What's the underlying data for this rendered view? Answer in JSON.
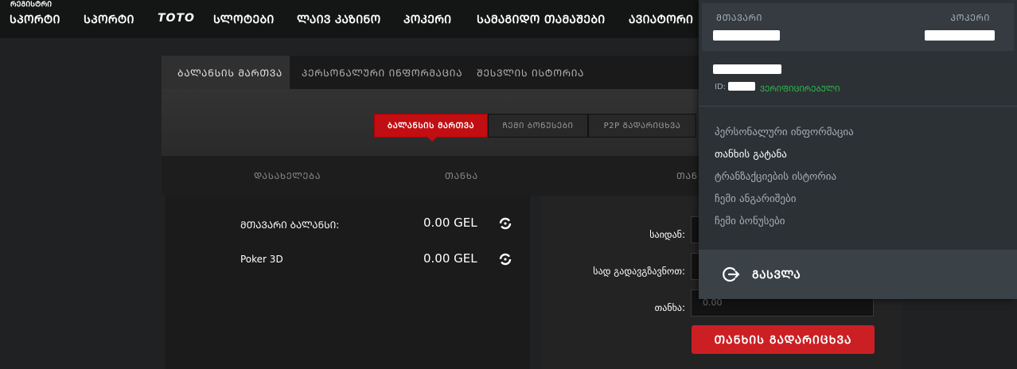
{
  "topnav": {
    "corner_text": "ᲠᲔᲒᲘᲡᲢᲠᲘ",
    "items": [
      {
        "label": "ᲡᲞᲝᲠᲢᲘ"
      },
      {
        "label": "ᲡᲞᲝᲠᲢᲘ"
      },
      {
        "label": "TOTO"
      },
      {
        "label": "ᲡᲚᲝᲢᲔᲑᲘ"
      },
      {
        "label": "ᲚᲐᲘᲕ ᲙᲐᲖᲘᲜᲝ"
      },
      {
        "label": "ᲞᲝᲙᲔᲠᲘ"
      },
      {
        "label": "ᲡᲐᲛᲐᲒᲘᲓᲝ ᲗᲐᲛᲐᲨᲔᲑᲘ"
      },
      {
        "label": "ᲐᲕᲘᲐᲢᲝᲠᲘ"
      }
    ]
  },
  "tabs": [
    {
      "label": "ᲑᲐᲚᲐᲜᲡᲘᲡ ᲛᲐᲠᲗᲕᲐ",
      "active": true
    },
    {
      "label": "ᲞᲔᲠᲡᲝᲜᲐᲚᲣᲠᲘ ᲘᲜᲤᲝᲠᲛᲐᲪᲘᲐ",
      "active": false
    },
    {
      "label": "ᲨᲔᲡᲕᲚᲘᲡ ᲘᲡᲢᲝᲠᲘᲐ",
      "active": false
    }
  ],
  "subtabs": [
    {
      "label": "ᲑᲐᲚᲐᲜᲡᲘᲡ ᲛᲐᲠᲗᲕᲐ",
      "active": true
    },
    {
      "label": "ᲩᲔᲛᲘ ᲑᲝᲜᲣᲡᲔᲑᲘ",
      "active": false
    },
    {
      "label": "P2P ᲒᲐᲓᲐᲠᲘᲪᲮᲕᲐ",
      "active": false
    }
  ],
  "balance_head": {
    "name_col": "ᲓᲐᲡᲐᲮᲔᲚᲔᲑᲐ",
    "amount_col": "ᲗᲐᲜᲮᲐ",
    "third_col": "ᲗᲐᲜ"
  },
  "balances": [
    {
      "name": "ᲛᲗᲐᲕᲐᲠᲘ ᲑᲐᲚᲐᲜᲡᲘ:",
      "amount": "0.00 GEL"
    },
    {
      "name": "Poker 3D",
      "amount": "0.00 GEL"
    }
  ],
  "transfer": {
    "from_label": "საიდან:",
    "to_label": "სად გადავგზავნოთ:",
    "amount_label": "თანხა:",
    "amount_placeholder": "0.00",
    "submit_label": "ᲗᲐᲜᲮᲘᲡ ᲒᲐᲓᲐᲠᲘᲪᲮᲕᲐ"
  },
  "dropdown": {
    "main_label": "ᲛᲗᲐᲕᲐᲠᲘ",
    "poker_label": "ᲞᲝᲙᲔᲠᲘ",
    "id_label": "ID:",
    "verified": "ᲕᲔᲠᲘᲤᲘᲪᲘᲠᲔᲑᲣᲚᲘ",
    "menu": [
      {
        "label": "პერსონალური ინფორმაცია",
        "current": false
      },
      {
        "label": "თანხის გატანა",
        "current": true
      },
      {
        "label": "ტრანზაქციების ისტორია",
        "current": false
      },
      {
        "label": "ჩემი ანგარიშები",
        "current": false
      },
      {
        "label": "ჩემი ბონუსები",
        "current": false
      }
    ],
    "logout_label": "ᲒᲐᲡᲕᲚᲐ"
  },
  "colors": {
    "accent_red": "#cc1f23",
    "verified_green": "#2fbe4c"
  }
}
